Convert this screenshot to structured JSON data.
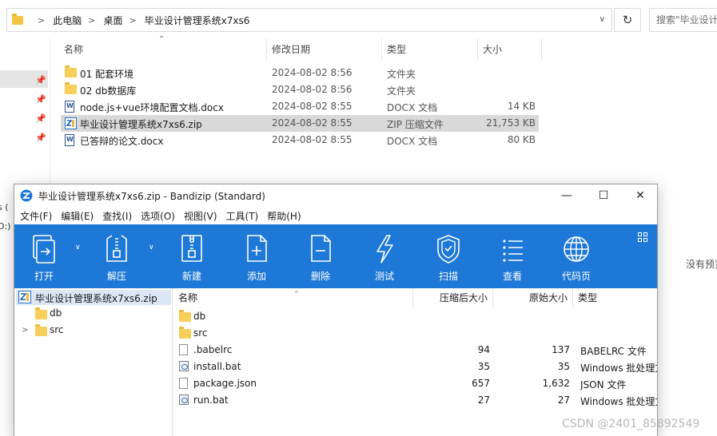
{
  "explorer": {
    "breadcrumb": [
      "此电脑",
      "桌面",
      "毕业设计管理系统x7xs6"
    ],
    "search_placeholder": "搜索\"毕业设计",
    "columns": {
      "name": "名称",
      "date": "修改日期",
      "type": "类型",
      "size": "大小"
    },
    "files": [
      {
        "name": "01  配套环境",
        "date": "2024-08-02 8:56",
        "type": "文件夹",
        "size": "",
        "icon": "folder-icon",
        "selected": false
      },
      {
        "name": "02 db数据库",
        "date": "2024-08-02 8:56",
        "type": "文件夹",
        "size": "",
        "icon": "folder-icon",
        "selected": false
      },
      {
        "name": "node.js+vue环境配置文档.docx",
        "date": "2024-08-02 8:55",
        "type": "DOCX 文档",
        "size": "14 KB",
        "icon": "docx-icon",
        "selected": false
      },
      {
        "name": "毕业设计管理系统x7xs6.zip",
        "date": "2024-08-02 8:55",
        "type": "ZIP 压缩文件",
        "size": "21,753 KB",
        "icon": "zip-icon",
        "selected": true
      },
      {
        "name": "已答辩的论文.docx",
        "date": "2024-08-02 8:55",
        "type": "DOCX 文档",
        "size": "80 KB",
        "icon": "docx-icon",
        "selected": false
      }
    ],
    "nav_fragments": [
      "s (",
      "D:)"
    ],
    "no_preview": "没有预览"
  },
  "bandizip": {
    "title": "毕业设计管理系统x7xs6.zip - Bandizip (Standard)",
    "menu": [
      "文件(F)",
      "编辑(E)",
      "查找(I)",
      "选项(O)",
      "视图(V)",
      "工具(T)",
      "帮助(H)"
    ],
    "toolbar": [
      {
        "label": "打开",
        "icon": "open-icon"
      },
      {
        "label": "解压",
        "icon": "extract-icon"
      },
      {
        "label": "新建",
        "icon": "new-archive-icon"
      },
      {
        "label": "添加",
        "icon": "add-icon"
      },
      {
        "label": "删除",
        "icon": "delete-icon"
      },
      {
        "label": "测试",
        "icon": "test-icon"
      },
      {
        "label": "扫描",
        "icon": "scan-icon"
      },
      {
        "label": "查看",
        "icon": "view-icon"
      },
      {
        "label": "代码页",
        "icon": "codepage-icon"
      }
    ],
    "tree": {
      "root": "毕业设计管理系统x7xs6.zip",
      "items": [
        {
          "label": "db"
        },
        {
          "label": "src"
        }
      ]
    },
    "list": {
      "columns": {
        "name": "名称",
        "compressed": "压缩后大小",
        "original": "原始大小",
        "type": "类型"
      },
      "rows": [
        {
          "name": "db",
          "compressed": "",
          "original": "",
          "type": "",
          "icon": "folder-icon"
        },
        {
          "name": "src",
          "compressed": "",
          "original": "",
          "type": "",
          "icon": "folder-icon"
        },
        {
          "name": ".babelrc",
          "compressed": "94",
          "original": "137",
          "type": "BABELRC 文件",
          "icon": "file-icon"
        },
        {
          "name": "install.bat",
          "compressed": "35",
          "original": "35",
          "type": "Windows 批处理文件",
          "icon": "bat-icon"
        },
        {
          "name": "package.json",
          "compressed": "657",
          "original": "1,632",
          "type": "JSON 文件",
          "icon": "file-icon"
        },
        {
          "name": "run.bat",
          "compressed": "27",
          "original": "27",
          "type": "Windows 批处理文件",
          "icon": "bat-icon"
        }
      ]
    }
  },
  "watermark": "CSDN @2401_85892549",
  "colors": {
    "toolbar_bg": "#1e78d7",
    "selection": "#d9d9d9",
    "tree_selection": "#dbe7f5"
  }
}
